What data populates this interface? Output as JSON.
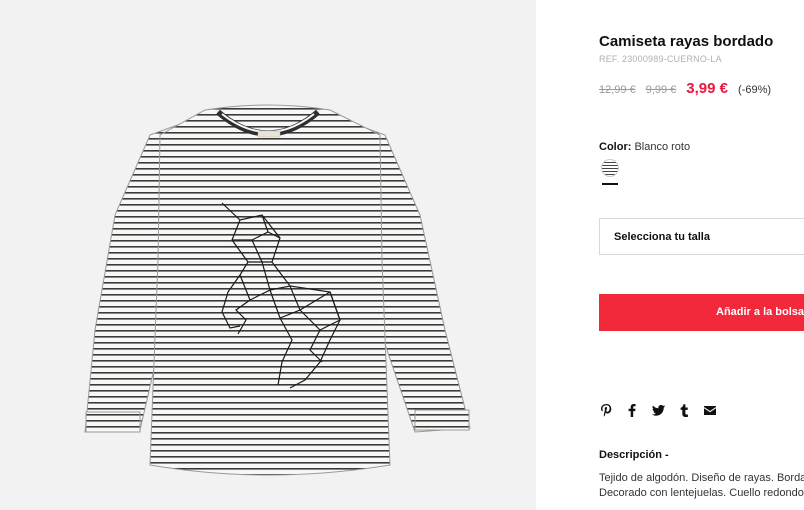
{
  "product": {
    "title": "Camiseta rayas bordado",
    "ref": "REF. 23000989-CUERNO-LA",
    "price_old_1": "12,99 €",
    "price_old_2": "9,99 €",
    "price_now": "3,99 €",
    "discount": "(-69%)"
  },
  "color": {
    "label": "Color:",
    "value": "Blanco roto"
  },
  "size": {
    "placeholder": "Selecciona tu talla"
  },
  "actions": {
    "add_to_bag": "Añadir a la bolsa"
  },
  "social": [
    "pinterest-icon",
    "facebook-icon",
    "twitter-icon",
    "tumblr-icon",
    "email-icon"
  ],
  "description": {
    "title": "Descripción -",
    "lines": [
      "Tejido de algodón. Diseño de rayas. Bordado",
      "Decorado con lentejuelas. Cuello redondo"
    ]
  },
  "colors": {
    "accent": "#f2293b",
    "price": "#e8193d",
    "photo_bg": "#f2f2f2"
  }
}
